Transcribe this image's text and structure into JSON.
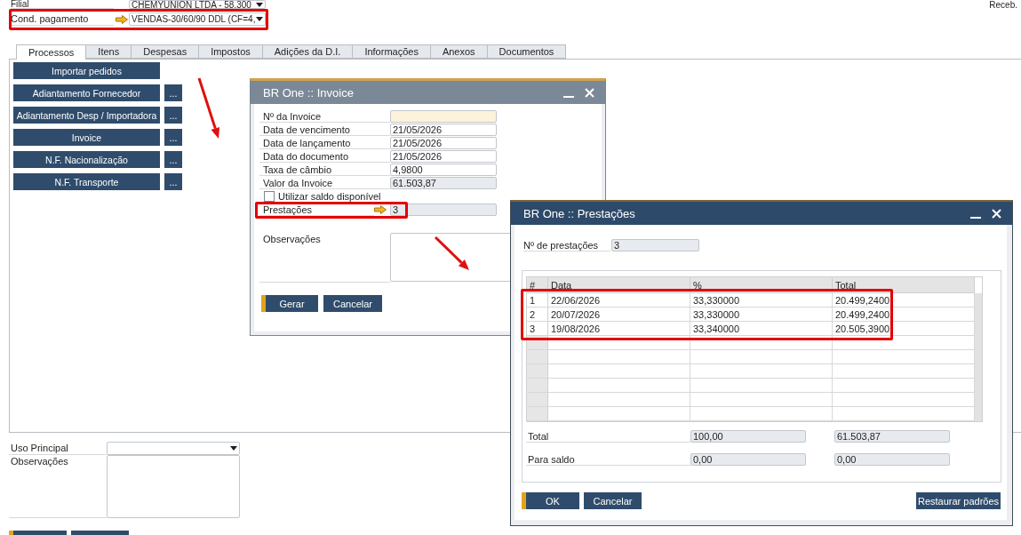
{
  "header": {
    "fields": [
      {
        "label": "Filial",
        "value": "CHEMYUNION LTDA - 58.300",
        "kind": "dropdown",
        "link": false,
        "highlighted": false
      },
      {
        "label": "Cond. pagamento",
        "value": "VENDAS-30/60/90 DDL (CF=4,",
        "kind": "dropdown",
        "link": true,
        "highlighted": true
      }
    ],
    "side_label": "Receb."
  },
  "tabs": [
    {
      "label": "Processos",
      "selected": true
    },
    {
      "label": "Itens",
      "selected": false
    },
    {
      "label": "Despesas",
      "selected": false
    },
    {
      "label": "Impostos",
      "selected": false
    },
    {
      "label": "Adições da D.I.",
      "selected": false
    },
    {
      "label": "Informações",
      "selected": false
    },
    {
      "label": "Anexos",
      "selected": false
    },
    {
      "label": "Documentos",
      "selected": false
    }
  ],
  "process_buttons": [
    {
      "label": "Importar pedidos"
    },
    {
      "label": "Adiantamento Fornecedor",
      "more": "..."
    },
    {
      "label": "Adiantamento Desp / Importadora",
      "more": "..."
    },
    {
      "label": "Invoice",
      "more": "..."
    },
    {
      "label": "N.F. Nacionalização",
      "more": "..."
    },
    {
      "label": "N.F. Transporte",
      "more": "..."
    }
  ],
  "footer": {
    "fields": [
      {
        "label": "Uso Principal",
        "kind": "dropdown"
      },
      {
        "label": "Observações",
        "kind": "textarea"
      }
    ],
    "buttons": [
      {
        "primary": true
      },
      {
        "primary": false
      }
    ]
  },
  "invoice_dialog": {
    "title": "BR One :: Invoice",
    "active": false,
    "fields": [
      {
        "kind": "text",
        "label": "Nº da Invoice",
        "focused": true
      },
      {
        "kind": "text",
        "label": "Data de vencimento",
        "value": "21/05/2026",
        "focused": false
      },
      {
        "kind": "text",
        "label": "Data de lançamento",
        "value": "21/05/2026",
        "focused": false
      },
      {
        "kind": "text",
        "label": "Data do documento",
        "value": "21/05/2026",
        "focused": false
      },
      {
        "kind": "text",
        "label": "Taxa de câmbio",
        "value": "4,9800",
        "focused": false
      },
      {
        "kind": "readonly",
        "label": "Valor da Invoice",
        "value": "61.503,87"
      },
      {
        "kind": "checkbox",
        "label": "Utilizar saldo disponível",
        "checked": false
      },
      {
        "kind": "link",
        "label": "Prestações",
        "value": "3",
        "highlighted": true
      },
      {
        "kind": "textarea",
        "label": "Observações"
      }
    ],
    "buttons": [
      {
        "label": "Gerar",
        "primary": true
      },
      {
        "label": "Cancelar",
        "primary": false
      }
    ]
  },
  "installments_dialog": {
    "title": "BR One :: Prestações",
    "active": true,
    "count": {
      "label": "Nº de prestações",
      "value": "3"
    },
    "table": {
      "columns": [
        "#",
        "Data",
        "%",
        "Total"
      ],
      "rows": [
        {
          "cells": [
            "1",
            "22/06/2026",
            "33,330000",
            "20.499,2400"
          ],
          "highlighted": true
        },
        {
          "cells": [
            "2",
            "20/07/2026",
            "33,330000",
            "20.499,2400"
          ],
          "highlighted": true
        },
        {
          "cells": [
            "3",
            "19/08/2026",
            "33,340000",
            "20.505,3900"
          ],
          "highlighted": true
        }
      ]
    },
    "totals": [
      {
        "label": "Total",
        "values": [
          "100,00",
          "61.503,87"
        ]
      },
      {
        "label": "Para saldo",
        "values": [
          "0,00",
          "0,00"
        ]
      }
    ],
    "buttons": [
      {
        "label": "OK",
        "primary": true
      },
      {
        "label": "Cancelar",
        "primary": false
      }
    ],
    "side_buttons": [
      {
        "label": "Restaurar padrões",
        "primary": false
      }
    ]
  }
}
